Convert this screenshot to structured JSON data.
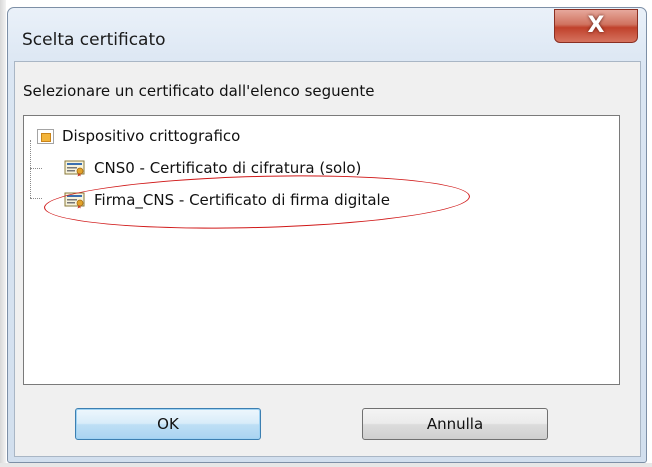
{
  "dialog": {
    "title": "Scelta certificato",
    "close_glyph": "X",
    "instruction": "Selezionare un certificato dall'elenco seguente"
  },
  "tree": {
    "root": {
      "label": "Dispositivo crittografico",
      "icon": "smartcard-device-icon"
    },
    "items": [
      {
        "label": "CNS0 - Certificato di cifratura (solo)",
        "icon": "certificate-icon"
      },
      {
        "label": "Firma_CNS - Certificato di firma digitale",
        "icon": "certificate-icon",
        "annotated": true
      }
    ]
  },
  "buttons": {
    "ok_label": "OK",
    "cancel_label": "Annulla"
  },
  "colors": {
    "close_button": "#c0412b",
    "annotation_ellipse": "#d01818",
    "ok_button": "#bedff5"
  }
}
